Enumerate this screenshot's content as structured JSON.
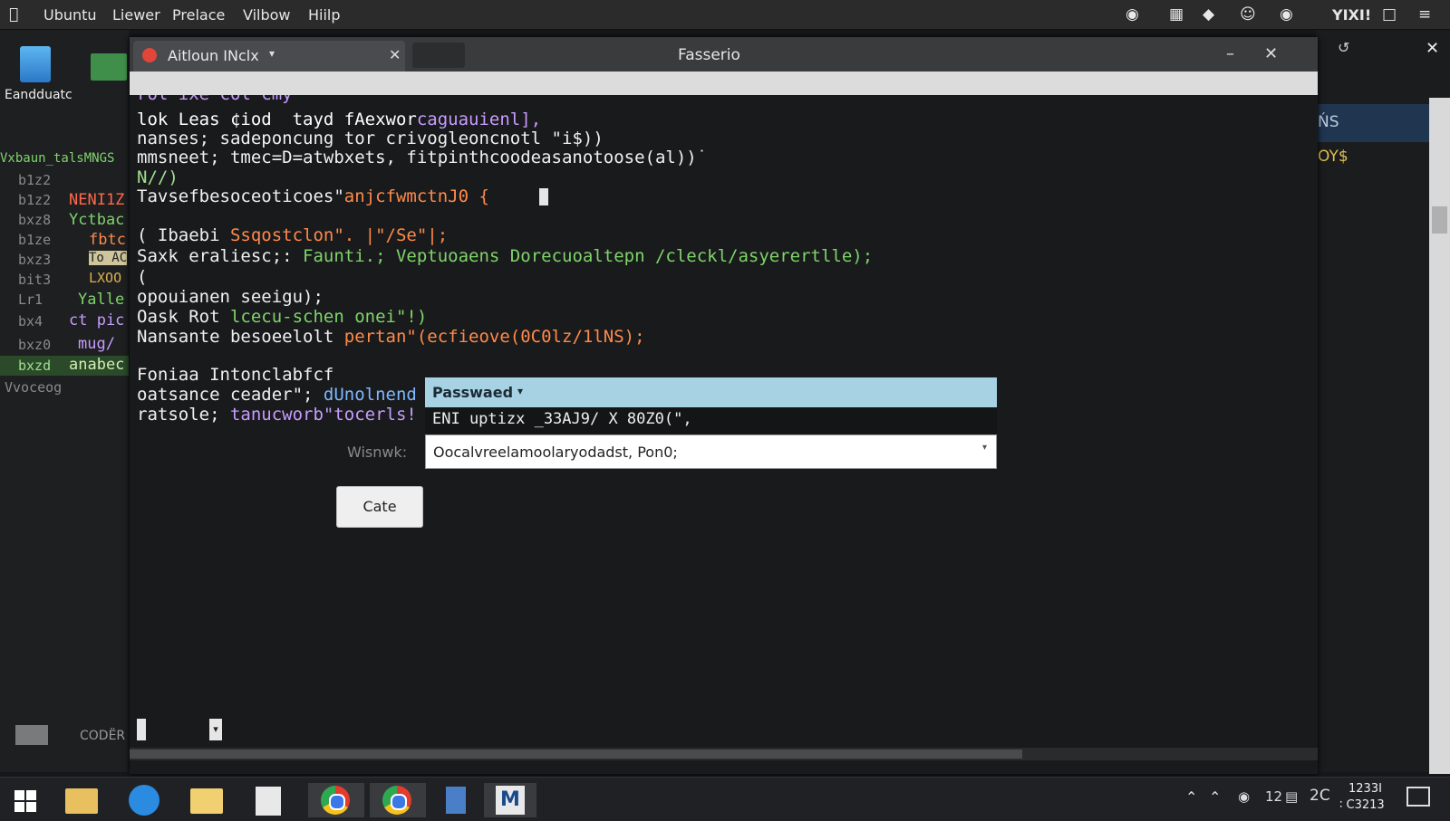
{
  "topbar": {
    "menus": [
      "Ubuntu",
      "Liewer",
      "Prelace",
      "Vilbow",
      "Hiilp"
    ],
    "right_label": "YIXI!"
  },
  "desktop": {
    "icon_label": "Eandduatc",
    "gutter_header": "Vxbaun_talsMNGS",
    "gutter_lines": [
      "b1z2",
      "b1z2",
      "bxz8",
      "b1ze",
      "bxz3",
      "bit3",
      "Lr1",
      "bx4",
      "bxz0",
      "bxzd",
      "Vvoceog"
    ],
    "gutter_code": [
      "",
      "NENI1Z",
      "Yctbac",
      "fbtc",
      "To AC",
      "LXOO",
      "Yalle",
      "ct pic",
      "mug/",
      "anabec",
      ""
    ],
    "bottom_label": "CODËR"
  },
  "right_strip": {
    "line1": "ŃS",
    "line2": "OY$"
  },
  "window": {
    "tab_title": "Aitloun INclx",
    "title": "Fasserio",
    "code_lines": [
      {
        "text": "lok Leas ¢iod  tayd fAexwor",
        "accent": "caguauienl],",
        "color": "#c89cff"
      },
      {
        "text": "nanses; sadeponcung tor crivogleoncnotl \"i$))",
        "accent": "",
        "color": "#f0f0f0"
      },
      {
        "text": "mmsneet; tmec=D=atwbxets, fitpinthcoodeasanotoose(al))˙",
        "accent": "",
        "color": "#c9a8ff"
      },
      {
        "text": "N//)",
        "accent": "",
        "color": "#f0f0f0"
      },
      {
        "text": "Tavsefbesoceoticoes\"",
        "accent": "anjcfwmctnJ0 {",
        "color": "#ffffff"
      },
      {
        "text": "",
        "accent": "",
        "color": "#fff"
      },
      {
        "text": "( Ibaebi ",
        "accent": "Ssqostclon\". |\"/Se\"|;",
        "color": "#ffffff"
      },
      {
        "text": "Saxk eraliesc;: ",
        "accent": "Faunti.; Veptuoaens Dorecuoaltepn /cleckl/asyerertlle);",
        "color": "#ffffff"
      },
      {
        "text": "(",
        "accent": "",
        "color": "#ffffff"
      },
      {
        "text": "opouianen seeigu);",
        "accent": "",
        "color": "#ffffff"
      },
      {
        "text": "Oask Rot ",
        "accent": "lcecu-schen onei\"!)",
        "color": "#ffffff"
      },
      {
        "text": "Nansante besoeelolt ",
        "accent": "pertan\"(ecfieove(0C0lz/1lNS);",
        "color": "#ffffff"
      },
      {
        "text": "",
        "accent": "",
        "color": "#fff"
      },
      {
        "text": "Foniaa Intonclabfcf",
        "accent": "",
        "color": "#ffffff"
      },
      {
        "text": "oatsance ceader\"; ",
        "accent": "dUnolnend",
        "color": "#ffffff"
      },
      {
        "text": "ratsole; ",
        "accent": "tanucworb\"tocerls!",
        "color": "#ffffff"
      }
    ],
    "password_popup": {
      "header": "Passwaed",
      "row_text": "ENI uptizx _33AJ9/ X 80Z0(\",",
      "field_label": "Wisnwk:",
      "input_value": "Oocalvreelamoolaryodadst, Pon0;"
    },
    "cate_button": "Cate"
  },
  "taskbar": {
    "clock_time": "1233I",
    "clock_date": "∶ C3213",
    "tray_text": "2C",
    "tray_num": "12"
  },
  "colors": {
    "accent_blue": "#a6d2e3",
    "code_orange": "#ff8a4a",
    "code_green": "#7fd46a",
    "code_purple": "#c89cff"
  }
}
